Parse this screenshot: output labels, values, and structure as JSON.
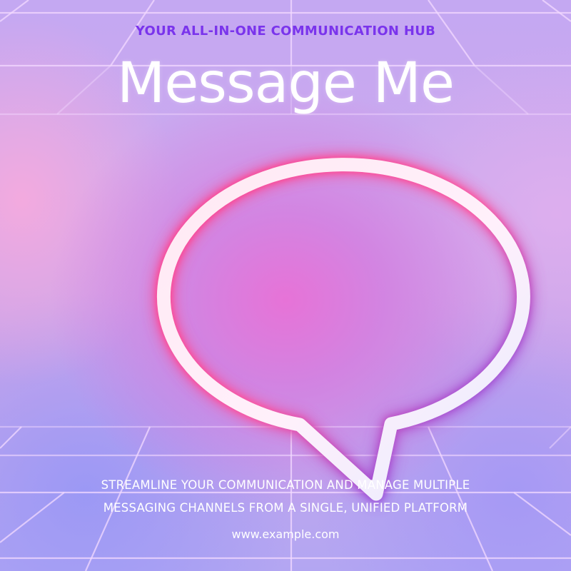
{
  "poster": {
    "tagline": "YOUR ALL-IN-ONE COMMUNICATION HUB",
    "title": "Message Me",
    "description_lines": [
      "STREAMLINE YOUR COMMUNICATION AND MANAGE MULTIPLE",
      "MESSAGING CHANNELS FROM A SINGLE, UNIFIED PLATFORM"
    ],
    "url": "www.example.com"
  },
  "icon": {
    "name": "speech-bubble-icon",
    "glow_colors": [
      "#ff3f8a",
      "#5b4dff"
    ]
  },
  "colors": {
    "tagline": "#7a34ec",
    "text": "#ffffff",
    "grid_lines": "#f3d9ff"
  }
}
